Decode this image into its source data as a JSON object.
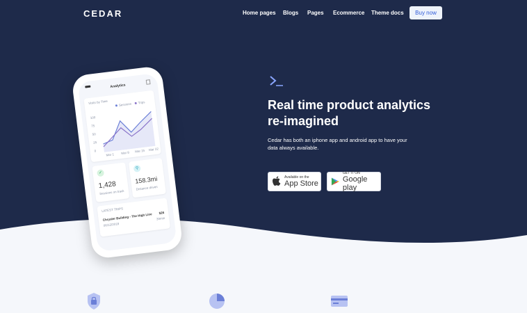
{
  "nav": {
    "brand": "CEDAR",
    "links": [
      "Home pages",
      "Blogs",
      "Pages",
      "Ecommerce",
      "Theme docs"
    ],
    "buy_label": "Buy now"
  },
  "hero": {
    "headline_1": "Real time product analytics",
    "headline_2": "re-imagined",
    "sub_1": "Cedar has both an iphone app and android app to have your",
    "sub_2": "data always available.",
    "appstore_small": "Available on the",
    "appstore_big": "App Store",
    "gplay_small": "GET IT ON",
    "gplay_big": "Google play"
  },
  "phone": {
    "title": "Analytics",
    "chart_title": "Visits by Time",
    "legend": [
      "Sessions",
      "Trips"
    ],
    "ytick": [
      "100",
      "75",
      "50",
      "25",
      "0"
    ],
    "xtick": [
      "Mar 1",
      "Mar 8",
      "Mar 15",
      "Mar 22"
    ],
    "stat1_value": "1,428",
    "stat1_label": "Sessions on track",
    "stat2_value": "158.3mi",
    "stat2_label": "Distance driven",
    "latest_title": "LATEST TRIPS",
    "trip_name": "Chrysler Building - The High Line",
    "trip_date": "06/12/2018",
    "trip_cost": "$26",
    "trip_extra": "39min"
  },
  "colors": {
    "hero_bg": "#1e2a4a",
    "accent": "#2f5bd8",
    "chart_a": "#6b7fd7",
    "chart_b": "#8a74c9"
  },
  "icons": [
    "terminal-prompt-icon",
    "apple-icon",
    "google-play-icon",
    "shield-icon",
    "pie-chart-icon",
    "credit-card-icon"
  ]
}
